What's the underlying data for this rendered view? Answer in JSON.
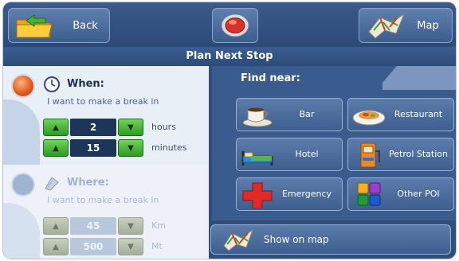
{
  "header": {
    "back_label": "Back",
    "map_label": "Map",
    "title": "Plan Next Stop"
  },
  "when": {
    "title": "When:",
    "subtitle": "I want to make a break in",
    "hours": {
      "value": "2",
      "unit": "hours"
    },
    "minutes": {
      "value": "15",
      "unit": "minutes"
    }
  },
  "where": {
    "title": "Where:",
    "subtitle": "I want to make a break in",
    "distance": {
      "value": "45",
      "unit": "Km"
    },
    "meters": {
      "value": "500",
      "unit": "Mt"
    }
  },
  "find_near": {
    "label": "Find near:",
    "buttons": [
      {
        "label": "Bar",
        "icon": "coffee-cup-icon"
      },
      {
        "label": "Restaurant",
        "icon": "dish-icon"
      },
      {
        "label": "Hotel",
        "icon": "bed-icon"
      },
      {
        "label": "Petrol Station",
        "icon": "fuel-pump-icon"
      },
      {
        "label": "Emergency",
        "icon": "red-cross-icon"
      },
      {
        "label": "Other POI",
        "icon": "poi-grid-icon"
      }
    ]
  },
  "show_on_map_label": "Show on map",
  "colors": {
    "accent_orange": "#e0561a",
    "stepper_green": "#2f9a22",
    "panel_blue": "#3a5b8e"
  }
}
